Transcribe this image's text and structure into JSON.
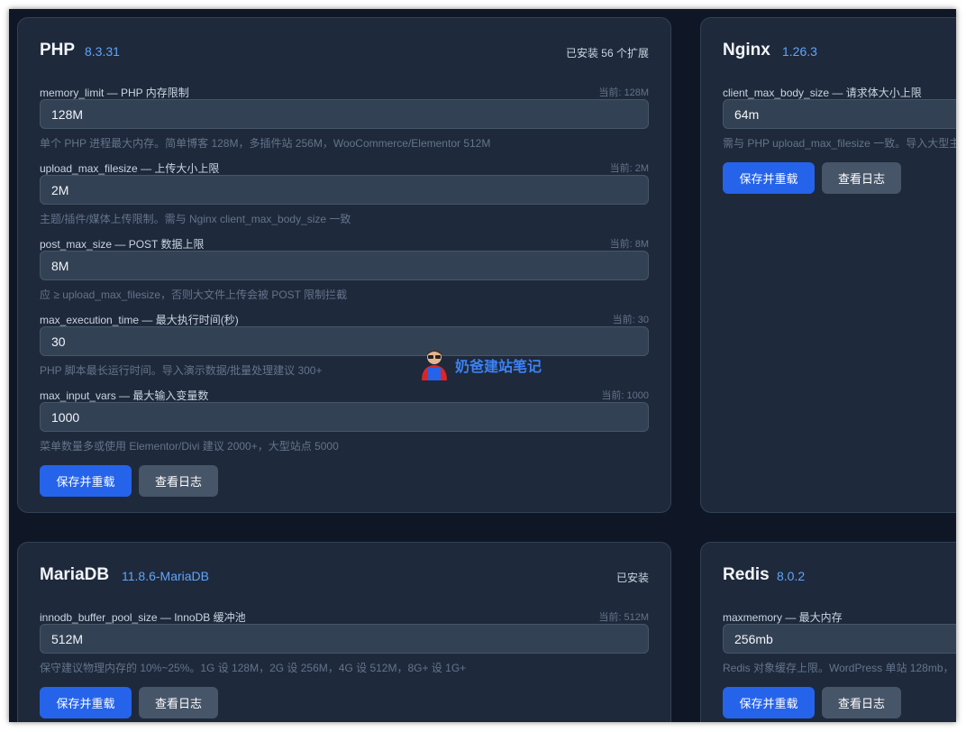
{
  "cards": {
    "php": {
      "title": "PHP",
      "version": "8.3.31",
      "meta": "已安装 56 个扩展",
      "fields": [
        {
          "label": "memory_limit — PHP 内存限制",
          "current": "当前: 128M",
          "value": "128M",
          "hint": "单个 PHP 进程最大内存。简单博客 128M，多插件站 256M，WooCommerce/Elementor 512M"
        },
        {
          "label": "upload_max_filesize — 上传大小上限",
          "current": "当前: 2M",
          "value": "2M",
          "hint": "主题/插件/媒体上传限制。需与 Nginx client_max_body_size 一致"
        },
        {
          "label": "post_max_size — POST 数据上限",
          "current": "当前: 8M",
          "value": "8M",
          "hint": "应 ≥ upload_max_filesize，否则大文件上传会被 POST 限制拦截"
        },
        {
          "label": "max_execution_time — 最大执行时间(秒)",
          "current": "当前: 30",
          "value": "30",
          "hint": "PHP 脚本最长运行时间。导入演示数据/批量处理建议 300+"
        },
        {
          "label": "max_input_vars — 最大输入变量数",
          "current": "当前: 1000",
          "value": "1000",
          "hint": "菜单数量多或使用 Elementor/Divi 建议 2000+，大型站点 5000"
        }
      ],
      "save_label": "保存并重载",
      "log_label": "查看日志"
    },
    "nginx": {
      "title": "Nginx",
      "version": "1.26.3",
      "fields": [
        {
          "label": "client_max_body_size — 请求体大小上限",
          "value": "64m",
          "hint": "需与 PHP upload_max_filesize 一致。导入大型主题"
        }
      ],
      "save_label": "保存并重载",
      "log_label": "查看日志"
    },
    "mariadb": {
      "title": "MariaDB",
      "version": "11.8.6-MariaDB",
      "meta": "已安装",
      "fields": [
        {
          "label": "innodb_buffer_pool_size — InnoDB 缓冲池",
          "current": "当前: 512M",
          "value": "512M",
          "hint": "保守建议物理内存的 10%~25%。1G 设 128M，2G 设 256M，4G 设 512M，8G+ 设 1G+"
        }
      ],
      "save_label": "保存并重载",
      "log_label": "查看日志"
    },
    "redis": {
      "title": "Redis",
      "version": "8.0.2",
      "fields": [
        {
          "label": "maxmemory — 最大内存",
          "value": "256mb",
          "hint": "Redis 对象缓存上限。WordPress 单站 128mb，"
        }
      ],
      "save_label": "保存并重载",
      "log_label": "查看日志"
    }
  },
  "watermark": {
    "text": "奶爸建站笔记"
  },
  "colors": {
    "background": "#0f1726",
    "card": "#1e293b",
    "accent": "#2563eb",
    "version": "#60a5fa"
  }
}
